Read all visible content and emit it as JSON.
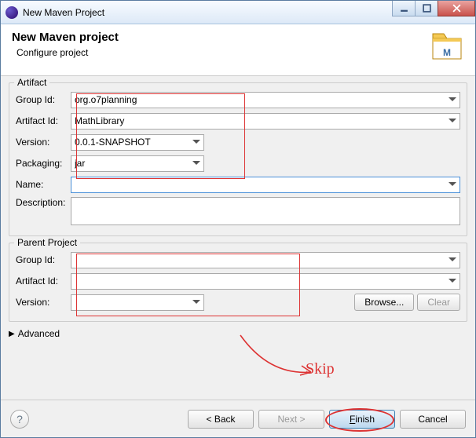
{
  "window": {
    "title": "New Maven Project"
  },
  "header": {
    "title": "New Maven project",
    "subtitle": "Configure project"
  },
  "artifact": {
    "legend": "Artifact",
    "groupId": {
      "label": "Group Id:",
      "value": "org.o7planning"
    },
    "artifactId": {
      "label": "Artifact Id:",
      "value": "MathLibrary"
    },
    "version": {
      "label": "Version:",
      "value": "0.0.1-SNAPSHOT"
    },
    "packaging": {
      "label": "Packaging:",
      "value": "jar"
    },
    "name": {
      "label": "Name:",
      "value": ""
    },
    "description": {
      "label": "Description:",
      "value": ""
    }
  },
  "parent": {
    "legend": "Parent Project",
    "groupId": {
      "label": "Group Id:",
      "value": ""
    },
    "artifactId": {
      "label": "Artifact Id:",
      "value": ""
    },
    "version": {
      "label": "Version:",
      "value": ""
    },
    "browse": "Browse...",
    "clear": "Clear"
  },
  "advanced": "Advanced",
  "footer": {
    "back": "< Back",
    "next": "Next >",
    "finish": "Finish",
    "cancel": "Cancel"
  },
  "annotation": {
    "skip": "Skip"
  }
}
